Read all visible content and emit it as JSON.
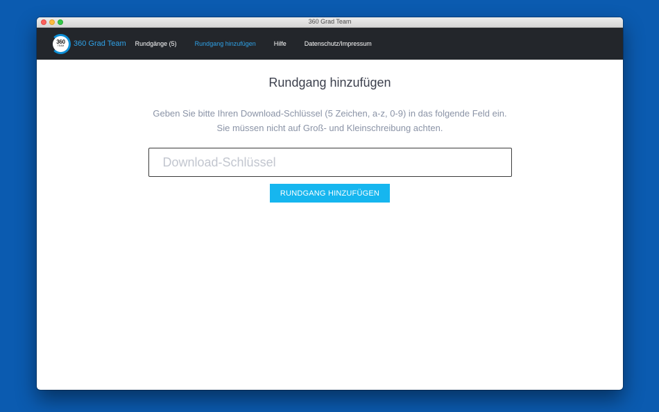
{
  "window": {
    "title": "360 Grad Team"
  },
  "brand": {
    "logo_number": "360",
    "logo_sub": "TEAM",
    "name": "360 Grad Team"
  },
  "nav": {
    "items": [
      {
        "label": "Rundgänge (5)",
        "active": false
      },
      {
        "label": "Rundgang hinzufügen",
        "active": true
      },
      {
        "label": "Hilfe",
        "active": false
      },
      {
        "label": "Datenschutz/Impressum",
        "active": false
      }
    ]
  },
  "main": {
    "title": "Rundgang hinzufügen",
    "instruction_line1": "Geben Sie bitte Ihren Download-Schlüssel (5 Zeichen, a-z, 0-9) in das folgende Feld ein.",
    "instruction_line2": "Sie müssen nicht auf Groß- und Kleinschreibung achten.",
    "input": {
      "placeholder": "Download-Schlüssel",
      "value": ""
    },
    "button_label": "RUNDGANG HINZUFÜGEN"
  },
  "colors": {
    "desktop": "#0b5bb0",
    "navbar": "#23262b",
    "accent": "#2fa2e8",
    "button": "#16b6ef"
  }
}
